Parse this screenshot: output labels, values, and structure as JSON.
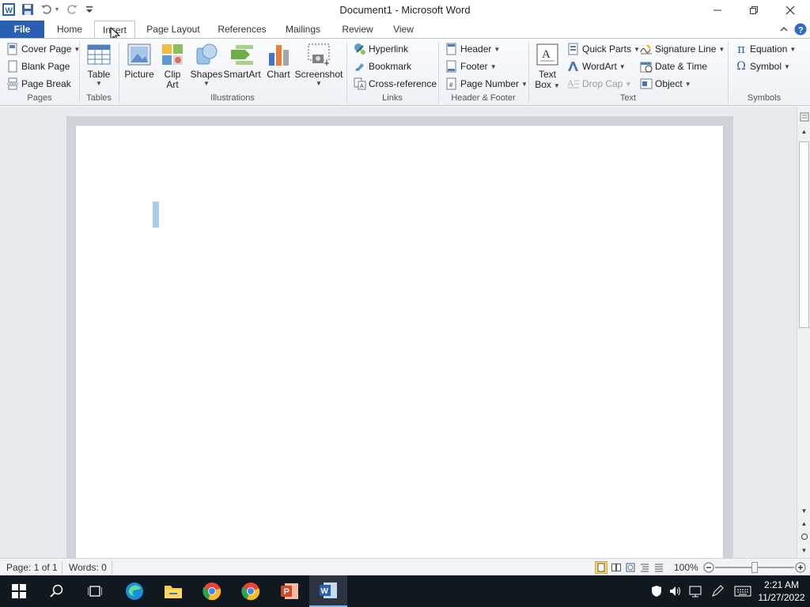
{
  "window": {
    "title": "Document1  -  Microsoft Word"
  },
  "quick_access": [
    "word-app-icon",
    "save-icon",
    "undo-icon",
    "redo-icon",
    "customize-icon"
  ],
  "tabs": [
    {
      "label": "File"
    },
    {
      "label": "Home"
    },
    {
      "label": "Insert"
    },
    {
      "label": "Page Layout"
    },
    {
      "label": "References"
    },
    {
      "label": "Mailings"
    },
    {
      "label": "Review"
    },
    {
      "label": "View"
    }
  ],
  "active_tab": "Insert",
  "ribbon": {
    "pages": {
      "group": "Pages",
      "cover_page": "Cover Page",
      "blank_page": "Blank Page",
      "page_break": "Page Break"
    },
    "tables": {
      "group": "Tables",
      "table": "Table"
    },
    "illustrations": {
      "group": "Illustrations",
      "picture": "Picture",
      "clip_art_1": "Clip",
      "clip_art_2": "Art",
      "shapes": "Shapes",
      "smartart": "SmartArt",
      "chart": "Chart",
      "screenshot": "Screenshot"
    },
    "links": {
      "group": "Links",
      "hyperlink": "Hyperlink",
      "bookmark": "Bookmark",
      "cross_reference": "Cross-reference"
    },
    "header_footer": {
      "group": "Header & Footer",
      "header": "Header",
      "footer": "Footer",
      "page_number": "Page Number"
    },
    "text": {
      "group": "Text",
      "text_box_1": "Text",
      "text_box_2": "Box",
      "quick_parts": "Quick Parts",
      "wordart": "WordArt",
      "drop_cap": "Drop Cap",
      "signature_line": "Signature Line",
      "date_time": "Date & Time",
      "object": "Object"
    },
    "symbols": {
      "group": "Symbols",
      "equation": "Equation",
      "symbol": "Symbol"
    }
  },
  "status": {
    "page": "Page: 1 of 1",
    "words": "Words: 0",
    "zoom": "100%"
  },
  "taskbar": {
    "apps": [
      "start-icon",
      "search-icon",
      "task-view-icon",
      "edge-icon",
      "file-explorer-icon",
      "chrome-icon",
      "chrome-icon",
      "powerpoint-icon",
      "word-icon"
    ],
    "time": "2:21 AM",
    "date": "11/27/2022"
  },
  "colors": {
    "file_tab": "#2b5fb4",
    "taskbar": "#101820",
    "doc_background": "#e7eaee"
  }
}
